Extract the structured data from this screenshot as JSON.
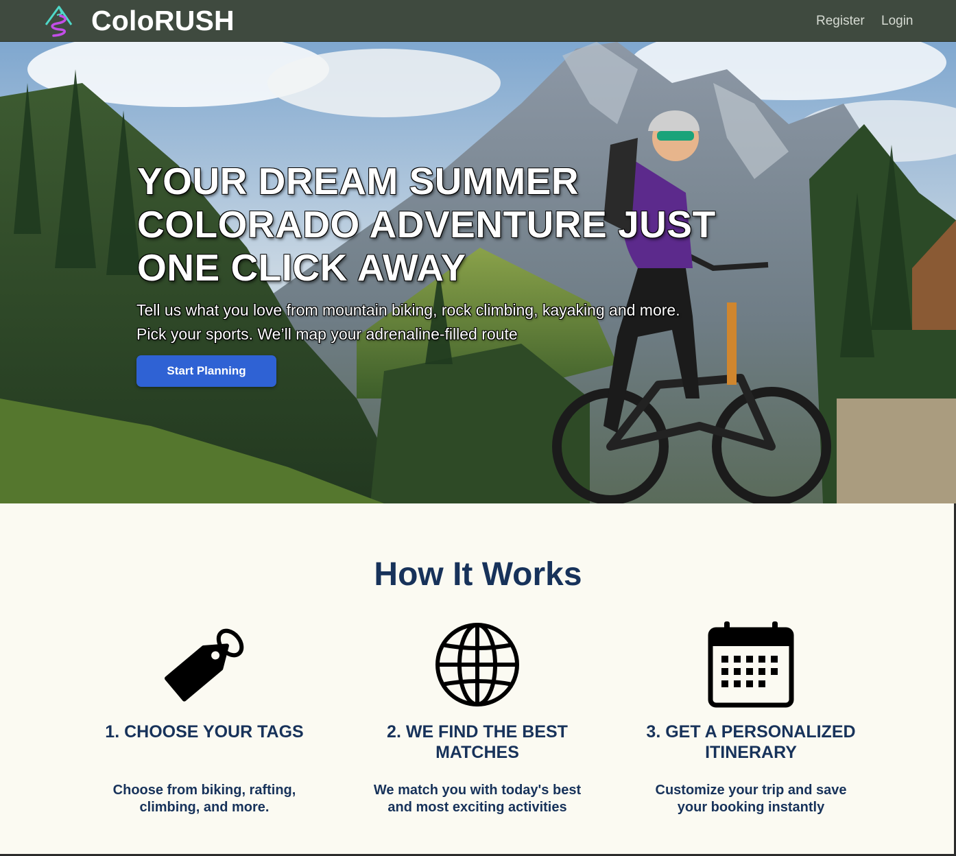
{
  "navbar": {
    "brand": "ColoRUSH",
    "logo_icon": "mountain-swirl-logo",
    "links": [
      {
        "label": "Register"
      },
      {
        "label": "Login"
      }
    ],
    "background_color": "#3f4a3f"
  },
  "hero": {
    "background_image": "mountain-biker-in-alpine-forest",
    "title": "YOUR DREAM SUMMER COLORADO ADVENTURE JUST ONE CLICK AWAY",
    "subtitle": "Tell us what you love from mountain biking, rock climbing, kayaking and more. Pick your sports. We’ll map your adrenaline-filled route",
    "cta_label": "Start Planning",
    "cta_color": "#2f62d4"
  },
  "how_it_works": {
    "title": "How It Works",
    "text_color": "#17325a",
    "steps": [
      {
        "icon": "tag-icon",
        "heading": "1. CHOOSE YOUR TAGS",
        "description": "Choose from biking, rafting, climbing, and more."
      },
      {
        "icon": "globe-icon",
        "heading": "2. WE FIND THE BEST MATCHES",
        "description": "We match you with today's best and most exciting activities"
      },
      {
        "icon": "calendar-icon",
        "heading": "3. GET A PERSONALIZED ITINERARY",
        "description": "Customize your trip and save your booking instantly"
      }
    ]
  }
}
